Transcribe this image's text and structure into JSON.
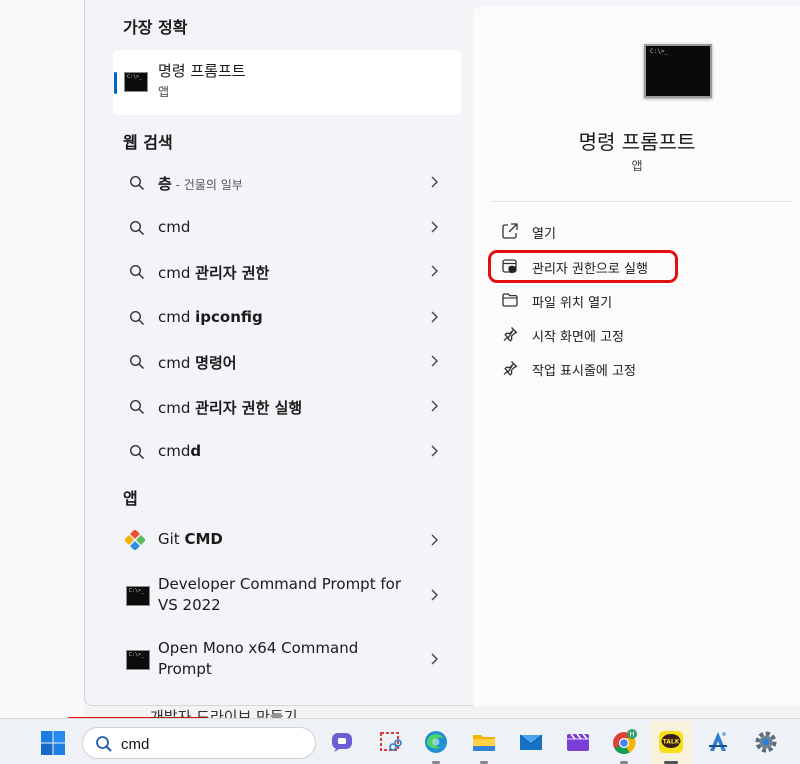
{
  "best_match": {
    "heading": "가장 정확",
    "title": "명령 프롬프트",
    "subtitle": "앱"
  },
  "web_search": {
    "heading": "웹 검색",
    "items": [
      {
        "prefix": "층",
        "hint": " - 건물의 일부",
        "bold": ""
      },
      {
        "prefix": "cmd",
        "hint": "",
        "bold": ""
      },
      {
        "prefix": "cmd ",
        "hint": "",
        "bold": "관리자 권한"
      },
      {
        "prefix": "cmd ",
        "hint": "",
        "bold": "ipconfig"
      },
      {
        "prefix": "cmd ",
        "hint": "",
        "bold": "명령어"
      },
      {
        "prefix": "cmd ",
        "hint": "",
        "bold": "관리자 권한 실행"
      },
      {
        "prefix": "cmd",
        "hint": "",
        "bold": "d"
      }
    ]
  },
  "apps": {
    "heading": "앱",
    "items": [
      {
        "prefix": "Git ",
        "bold": "CMD"
      },
      {
        "line1": "Developer Command Prompt for",
        "line2": "VS 2022"
      },
      {
        "line1": "Open Mono x64 Command",
        "line2": "Prompt"
      }
    ]
  },
  "preview": {
    "title": "명령 프롬프트",
    "subtitle": "앱",
    "actions": [
      {
        "label": "열기",
        "icon": "open-icon"
      },
      {
        "label": "관리자 권한으로 실행",
        "icon": "admin-shield-icon"
      },
      {
        "label": "파일 위치 열기",
        "icon": "folder-icon"
      },
      {
        "label": "시작 화면에 고정",
        "icon": "pin-icon"
      },
      {
        "label": "작업 표시줄에 고정",
        "icon": "pin-icon"
      }
    ]
  },
  "peek_text": "개발자 드라이브 만들기",
  "taskbar": {
    "search_value": "cmd",
    "icons": [
      "windows-start-icon",
      "search-icon",
      "teams-chat-icon",
      "snipping-tool-icon",
      "edge-icon",
      "file-explorer-icon",
      "mail-icon",
      "clipchamp-icon",
      "chrome-icon",
      "kakaotalk-icon",
      "appstore-icon",
      "settings-icon"
    ],
    "kakao_label": "TALK",
    "chrome_badge": "H"
  },
  "colors": {
    "highlight": "#e01010",
    "accent": "#0067c0"
  }
}
